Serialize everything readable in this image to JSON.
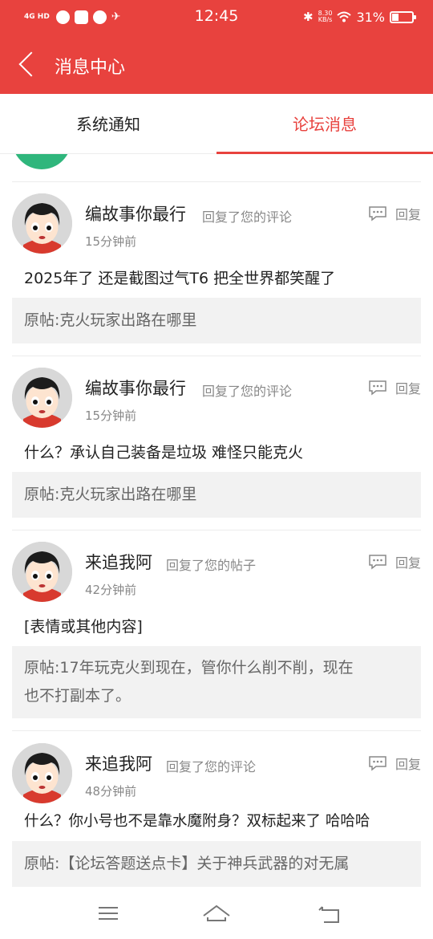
{
  "status_bar": {
    "network": "4G HD",
    "time": "12:45",
    "speed_value": "8.30",
    "speed_unit": "KB/s",
    "battery": "31%"
  },
  "header": {
    "title": "消息中心"
  },
  "tabs": [
    {
      "label": "系统通知",
      "active": false
    },
    {
      "label": "论坛消息",
      "active": true
    }
  ],
  "reply_label": "回复",
  "messages": [
    {
      "user": "编故事你最行",
      "action": "回复了您的评论",
      "time": "15分钟前",
      "content": "2025年了 还是截图过气T6 把全世界都笑醒了",
      "original": "原帖:克火玩家出路在哪里"
    },
    {
      "user": "编故事你最行",
      "action": "回复了您的评论",
      "time": "15分钟前",
      "content": "什么？承认自己装备是垃圾  难怪只能克火",
      "original": "原帖:克火玩家出路在哪里"
    },
    {
      "user": "来追我阿",
      "action": "回复了您的帖子",
      "time": "42分钟前",
      "content": "[表情或其他内容]",
      "original_line1": "原帖:17年玩克火到现在，管你什么削不削，现在",
      "original_line2": "也不打副本了。"
    },
    {
      "user": "来追我阿",
      "action": "回复了您的评论",
      "time": "48分钟前",
      "content": "什么？你小号也不是靠水魔附身？双标起来了  哈哈哈",
      "original": "原帖:【论坛答题送点卡】关于神兵武器的对无属"
    }
  ],
  "colors": {
    "accent": "#e8423e",
    "quote_bg": "#f2f2f2",
    "muted_text": "#888888"
  }
}
